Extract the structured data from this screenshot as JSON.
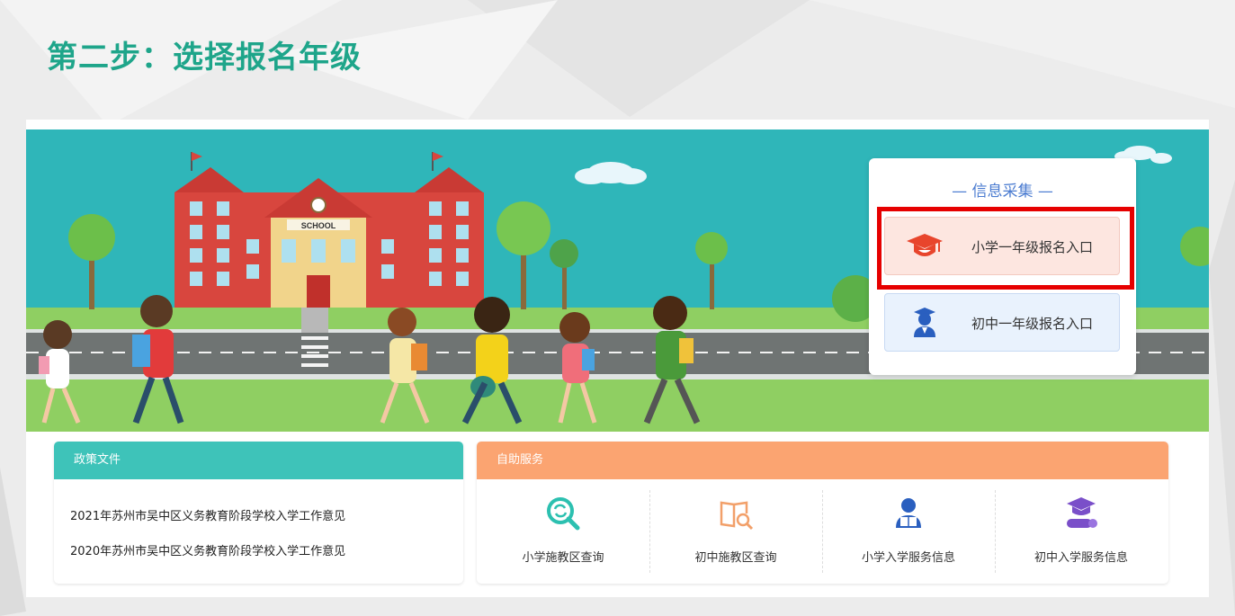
{
  "page": {
    "step_title": "第二步：选择报名年级"
  },
  "info_panel": {
    "title": "— 信息采集 —",
    "entries": [
      {
        "label": "小学一年级报名入口",
        "icon": "graduation-cap-icon"
      },
      {
        "label": "初中一年级报名入口",
        "icon": "student-icon"
      }
    ]
  },
  "hero": {
    "school_sign": "SCHOOL"
  },
  "policy": {
    "header": "政策文件",
    "links": [
      "2021年苏州市吴中区义务教育阶段学校入学工作意见",
      "2020年苏州市吴中区义务教育阶段学校入学工作意见"
    ]
  },
  "service": {
    "header": "自助服务",
    "items": [
      {
        "label": "小学施教区查询",
        "icon": "search-refresh-icon"
      },
      {
        "label": "初中施教区查询",
        "icon": "book-search-icon"
      },
      {
        "label": "小学入学服务信息",
        "icon": "reading-student-icon"
      },
      {
        "label": "初中入学服务信息",
        "icon": "diploma-cap-icon"
      }
    ]
  },
  "colors": {
    "title_green": "#1ea58a",
    "info_blue": "#4a7bd0",
    "policy_teal": "#3ec3b9",
    "service_orange": "#fba471",
    "highlight_red": "#e60000"
  }
}
